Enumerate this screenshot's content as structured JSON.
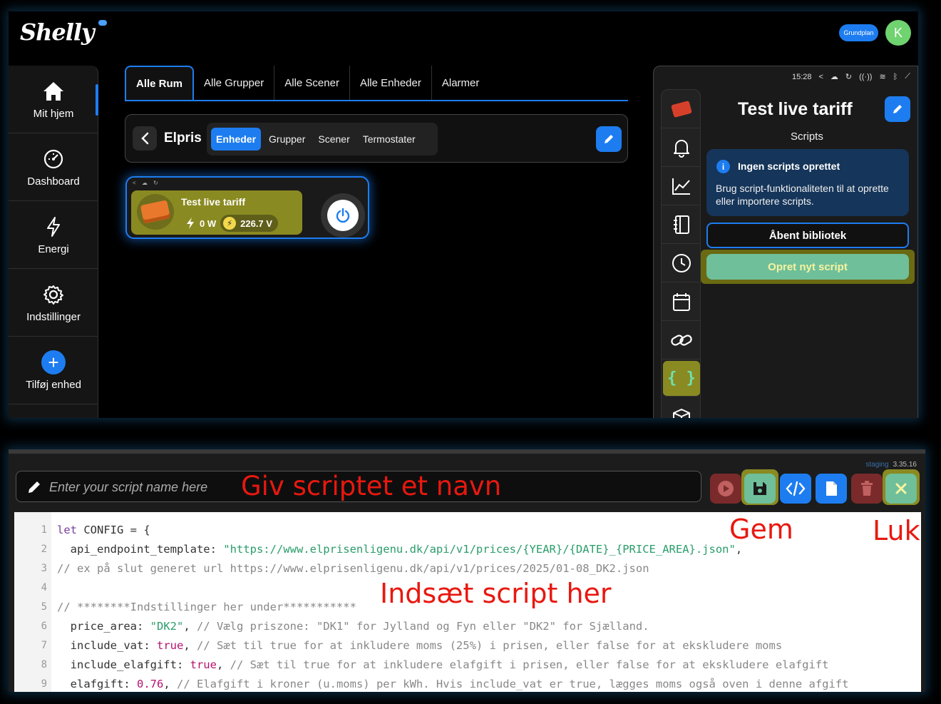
{
  "app": {
    "logo": "Shelly",
    "plan_badge": "Grundplan",
    "avatar_initial": "K"
  },
  "sidebar": {
    "items": [
      {
        "label": "Mit hjem",
        "icon": "home-icon"
      },
      {
        "label": "Dashboard",
        "icon": "gauge-icon"
      },
      {
        "label": "Energi",
        "icon": "lightning-icon"
      },
      {
        "label": "Indstillinger",
        "icon": "gear-icon"
      },
      {
        "label": "Tilføj enhed",
        "icon": "plus-icon"
      }
    ]
  },
  "tabs": [
    "Alle Rum",
    "Alle Grupper",
    "Alle Scener",
    "Alle Enheder",
    "Alarmer"
  ],
  "room": {
    "name": "Elpris",
    "segments": [
      "Enheder",
      "Grupper",
      "Scener",
      "Termostater"
    ]
  },
  "device": {
    "name": "Test live tariff",
    "power": "0 W",
    "voltage": "226.7 V"
  },
  "right_panel": {
    "time": "15:28",
    "title": "Test live tariff",
    "subtitle": "Scripts",
    "info_heading": "Ingen scripts oprettet",
    "info_text": "Brug script-funktionaliteten til at oprette eller importere scripts.",
    "library_button": "Åbent bibliotek",
    "new_script_button": "Opret nyt script"
  },
  "editor": {
    "version_tag": "staging",
    "version": "3.35.16",
    "name_placeholder": "Enter your script name here",
    "annotations": {
      "name": "Giv scriptet et navn",
      "save": "Gem",
      "close": "Luk",
      "insert": "Indsæt script her"
    },
    "lines": [
      "let CONFIG = {",
      "  api_endpoint_template: \"https://www.elprisenligenu.dk/api/v1/prices/{YEAR}/{DATE}_{PRICE_AREA}.json\",",
      "// ex på slut generet url https://www.elprisenligenu.dk/api/v1/prices/2025/01-08_DK2.json",
      "",
      "// ********Indstillinger her under***********",
      "  price_area: \"DK2\", // Vælg priszone: \"DK1\" for Jylland og Fyn eller \"DK2\" for Sjælland.",
      "  include_vat: true, // Sæt til true for at inkludere moms (25%) i prisen, eller false for at ekskludere moms",
      "  include_elafgift: true, // Sæt til true for at inkludere elafgift i prisen, eller false for at ekskludere elafgift",
      "  elafgift: 0.76, // Elafgift i kroner (u.moms) per kWh. Hvis include_vat er true, lægges moms også oven i denne afgift"
    ]
  }
}
